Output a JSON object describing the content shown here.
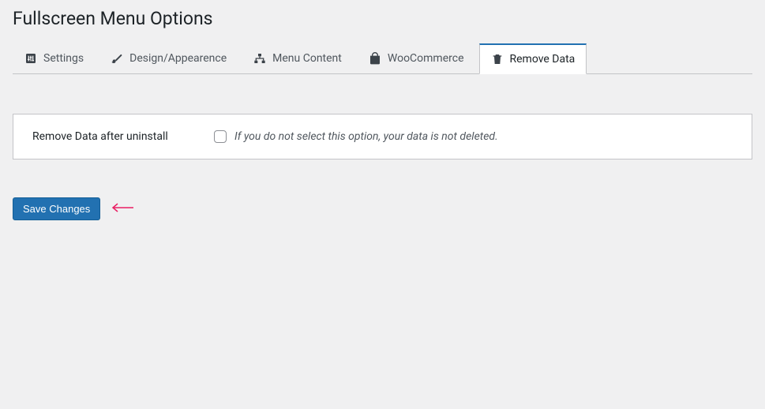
{
  "page_title": "Fullscreen Menu Options",
  "tabs": {
    "settings": "Settings",
    "design": "Design/Appearence",
    "menu_content": "Menu Content",
    "woocommerce": "WooCommerce",
    "remove_data": "Remove Data"
  },
  "active_tab": "remove_data",
  "option": {
    "label": "Remove Data after uninstall",
    "description": "If you do not select this option, your data is not deleted.",
    "checked": false
  },
  "save_button": "Save Changes"
}
